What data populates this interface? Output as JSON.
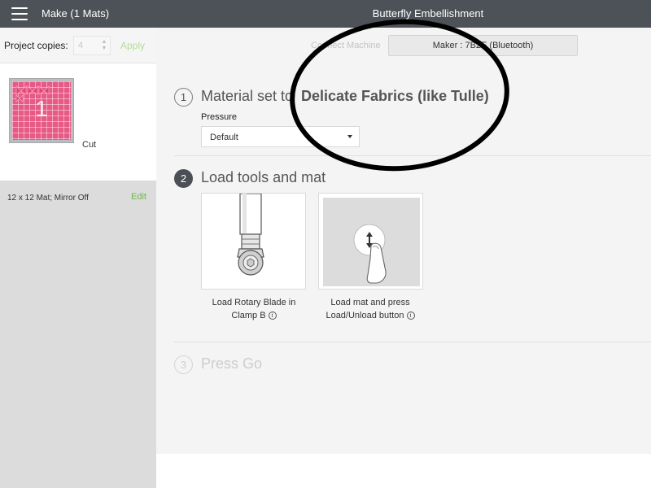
{
  "header": {
    "make_title": "Make (1 Mats)",
    "project_title": "Butterfly Embellishment"
  },
  "sidebar": {
    "copies_label": "Project copies:",
    "copies_value": "4",
    "apply_label": "Apply",
    "mat": {
      "number": "1",
      "cut_label": "Cut",
      "info": "12 x 12 Mat; Mirror Off",
      "edit_label": "Edit"
    }
  },
  "main": {
    "connect_label": "Connect Machine",
    "machine_button": "Maker : 7B2E (Bluetooth)",
    "step1": {
      "number": "1",
      "title_prefix": "Material set to",
      "material": "Delicate Fabrics (like Tulle)",
      "pressure_label": "Pressure",
      "pressure_value": "Default"
    },
    "step2": {
      "number": "2",
      "title": "Load tools and mat",
      "card1": {
        "line1": "Load Rotary Blade in",
        "line2": "Clamp B"
      },
      "card2": {
        "line1": "Load mat and press",
        "line2": "Load/Unload button"
      }
    },
    "step3": {
      "number": "3",
      "title": "Press Go"
    }
  },
  "colors": {
    "topbar": "#4c5257",
    "accent_green": "#6cb84a",
    "mat_pink": "#e75a86",
    "annotation": "#000000"
  },
  "icons": [
    "menu-icon",
    "caret-down-icon",
    "info-icon",
    "rotary-blade-icon",
    "load-unload-icon"
  ]
}
